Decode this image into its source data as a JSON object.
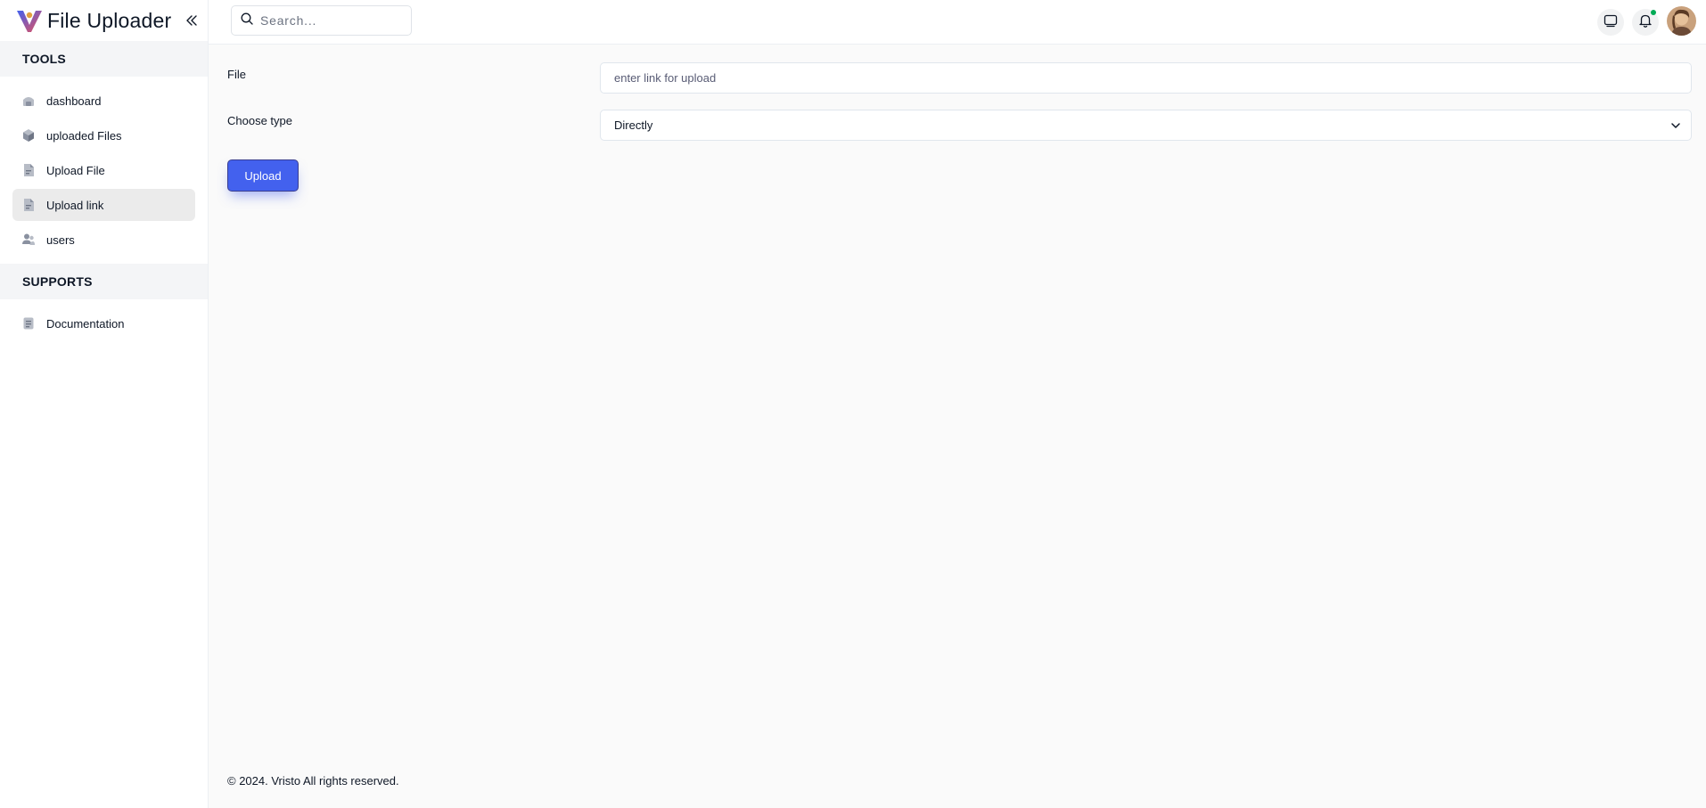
{
  "brand": {
    "title": "File Uploader",
    "logo_icon": "vristo-v-logo"
  },
  "colors": {
    "accent": "#4361ee",
    "status_dot": "#00ab55",
    "active_bg": "#ebebeb"
  },
  "sidebar": {
    "sections": [
      {
        "title": "TOOLS",
        "items": [
          {
            "label": "dashboard",
            "icon": "dashboard-icon"
          },
          {
            "label": "uploaded Files",
            "icon": "cube-icon"
          },
          {
            "label": "Upload File",
            "icon": "file-icon"
          },
          {
            "label": "Upload link",
            "icon": "file-link-icon",
            "active": true
          },
          {
            "label": "users",
            "icon": "users-icon"
          }
        ]
      },
      {
        "title": "SUPPORTS",
        "items": [
          {
            "label": "Documentation",
            "icon": "document-icon"
          }
        ]
      }
    ]
  },
  "header": {
    "search_placeholder": "Search...",
    "icons": [
      "chat-icon",
      "bell-icon",
      "avatar"
    ]
  },
  "form": {
    "file_label": "File",
    "file_placeholder": "enter link for upload",
    "type_label": "Choose type",
    "type_value": "Directly",
    "submit_label": "Upload"
  },
  "footer": {
    "text": "© 2024. Vristo All rights reserved."
  }
}
